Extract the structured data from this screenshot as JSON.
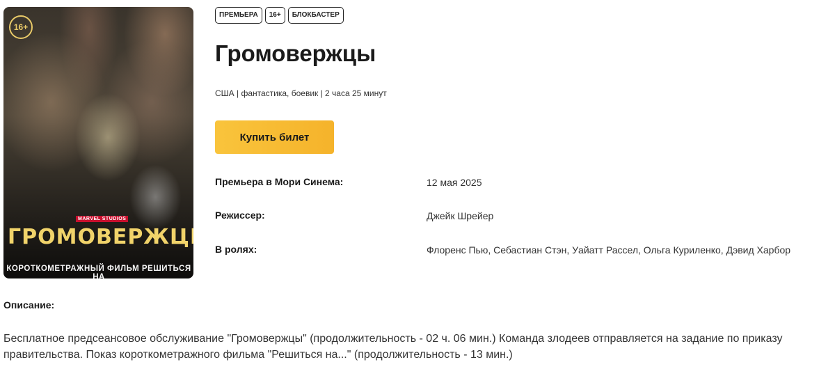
{
  "poster": {
    "age_badge": "16+",
    "studio": "MARVEL STUDIOS",
    "title": "ГРОМОВЕРЖЦЫ*",
    "subtitle": "КОРОТКОМЕТРАЖНЫЙ ФИЛЬМ РЕШИТЬСЯ НА"
  },
  "tags": [
    "ПРЕМЬЕРА",
    "16+",
    "БЛОКБАСТЕР"
  ],
  "movie": {
    "title": "Громовержцы",
    "meta": "США | фантастика, боевик | 2 часа 25 минут",
    "buy_label": "Купить билет"
  },
  "details": {
    "premiere_label": "Премьера в Мори Синема:",
    "premiere_value": "12 мая 2025",
    "director_label": "Режиссер:",
    "director_value": "Джейк Шрейер",
    "cast_label": "В ролях:",
    "cast_value": "Флоренс Пью, Себастиан Стэн, Уайатт Рассел, Ольга Куриленко, Дэвид Харбор"
  },
  "description": {
    "label": "Описание:",
    "text": "Бесплатное предсеансовое обслуживание \"Громовержцы\" (продолжительность - 02 ч. 06 мин.) Команда злодеев отправляется на задание по приказу правительства. Показ короткометражного фильма \"Решиться на...\" (продолжительность - 13 мин.)"
  },
  "colors": {
    "button": "#f7bd35",
    "poster_title": "#f1d36a"
  }
}
